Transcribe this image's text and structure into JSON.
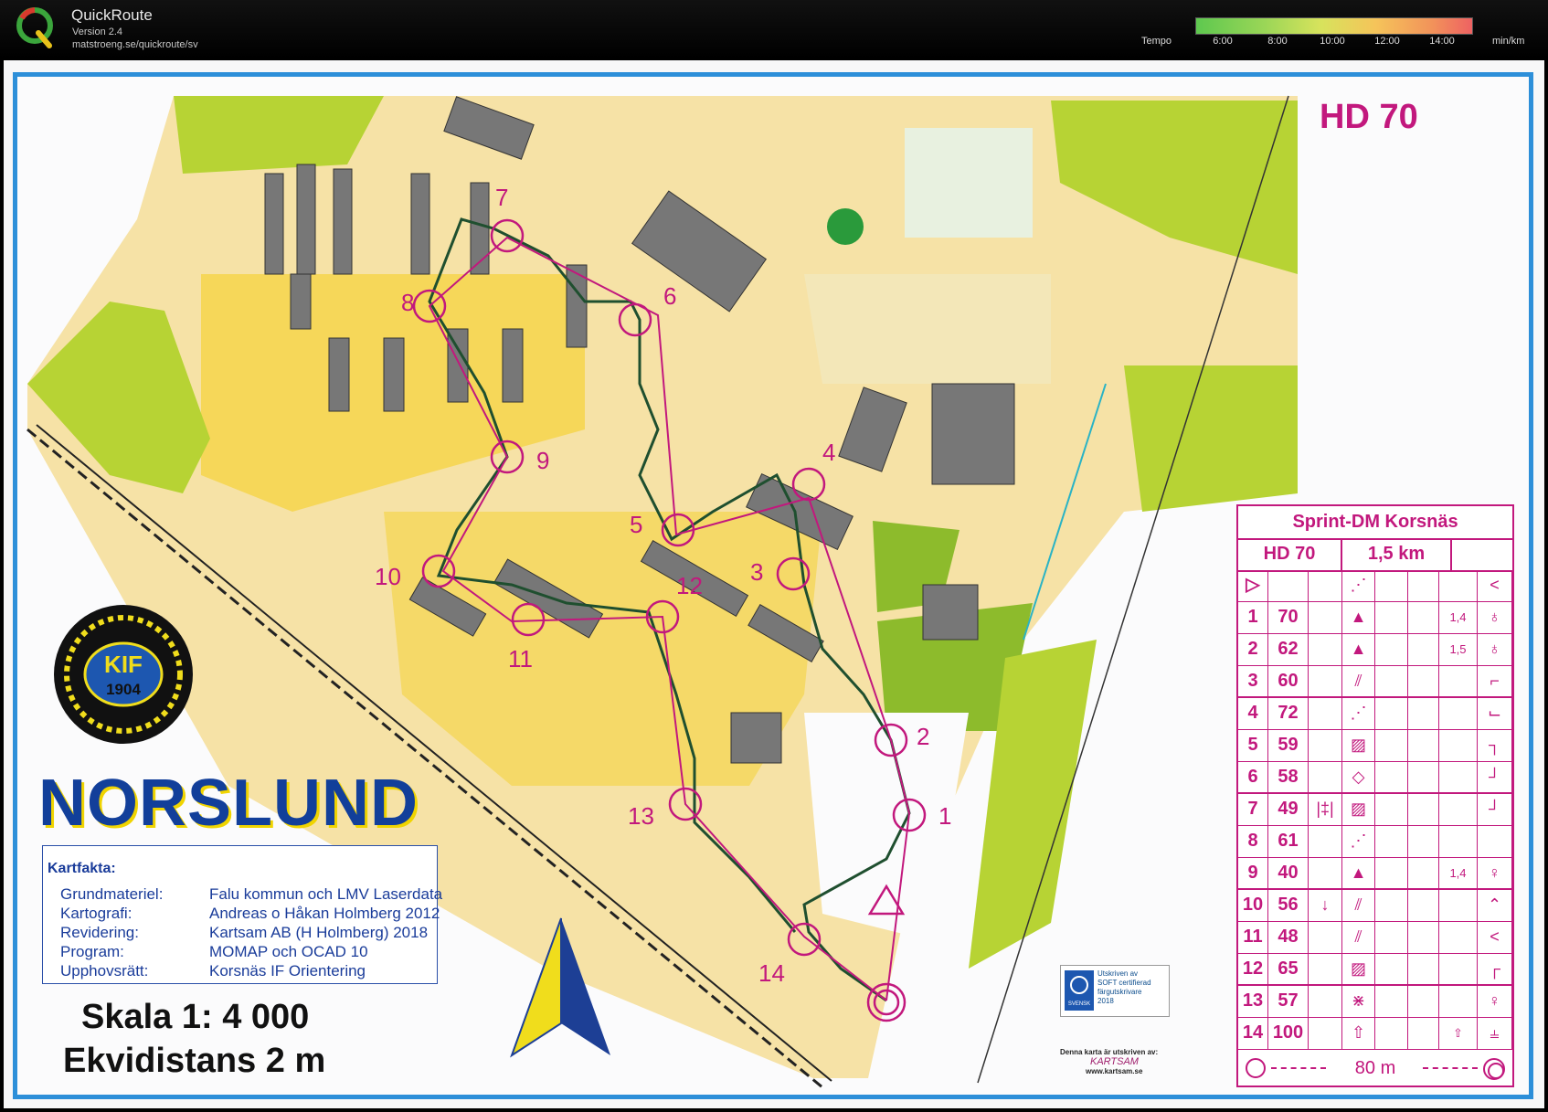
{
  "app": {
    "name": "QuickRoute",
    "version": "Version 2.4",
    "url": "matstroeng.se/quickroute/sv",
    "tempo_label": "Tempo",
    "tempo_ticks": [
      "6:00",
      "8:00",
      "10:00",
      "12:00",
      "14:00"
    ],
    "tempo_unit": "min/km"
  },
  "map": {
    "name": "NORSLUND",
    "course": "HD 70",
    "scale": "Skala 1: 4 000",
    "equidistance": "Ekvidistans 2 m",
    "club_logo": {
      "top": "KIF",
      "year": "1904"
    },
    "facts": {
      "heading": "Kartfakta:",
      "rows": [
        {
          "key": "Grundmateriel:",
          "value": "Falu kommun och LMV Laserdata"
        },
        {
          "key": "Kartografi:",
          "value": "Andreas o Håkan Holmberg 2012"
        },
        {
          "key": "Revidering:",
          "value": "Kartsam AB (H Holmberg) 2018"
        },
        {
          "key": "Program:",
          "value": "MOMAP och OCAD 10"
        },
        {
          "key": "Upphovsrätt:",
          "value": "Korsnäs IF Orientering"
        }
      ]
    },
    "printer_badge": {
      "line1": "Utskriven av",
      "line2": "SOFT certifierad",
      "line3": "färgutskrivare",
      "brand": "SVENSK",
      "year": "2018"
    },
    "printed_by": "Denna karta är utskriven av:",
    "printer_name": "KARTSAM",
    "printer_url": "www.kartsam.se",
    "control_labels": [
      "1",
      "2",
      "3",
      "4",
      "5",
      "6",
      "7",
      "8",
      "9",
      "10",
      "11",
      "12",
      "13",
      "14"
    ]
  },
  "control_description": {
    "title": "Sprint-DM Korsnäs",
    "class": "HD 70",
    "length": "1,5 km",
    "rows": [
      {
        "n": "1",
        "code": "70",
        "g": "",
        "feature": "▲",
        "dim": "1,4",
        "detail": "♁"
      },
      {
        "n": "2",
        "code": "62",
        "g": "",
        "feature": "▲",
        "dim": "1,5",
        "detail": "♁"
      },
      {
        "n": "3",
        "code": "60",
        "g": "",
        "feature": "⫽",
        "dim": "",
        "detail": "⌐"
      },
      {
        "n": "4",
        "code": "72",
        "g": "",
        "feature": "⋰",
        "dim": "",
        "detail": "⌙"
      },
      {
        "n": "5",
        "code": "59",
        "g": "",
        "feature": "▨",
        "dim": "",
        "detail": "┐"
      },
      {
        "n": "6",
        "code": "58",
        "g": "",
        "feature": "◇",
        "dim": "",
        "detail": "┘"
      },
      {
        "n": "7",
        "code": "49",
        "g": "|‡|",
        "feature": "▨",
        "dim": "",
        "detail": "┘"
      },
      {
        "n": "8",
        "code": "61",
        "g": "",
        "feature": "⋰",
        "dim": "",
        "detail": ""
      },
      {
        "n": "9",
        "code": "40",
        "g": "",
        "feature": "▲",
        "dim": "1,4",
        "detail": "♀"
      },
      {
        "n": "10",
        "code": "56",
        "g": "↓",
        "feature": "⫽",
        "dim": "",
        "detail": "⌃"
      },
      {
        "n": "11",
        "code": "48",
        "g": "",
        "feature": "⫽",
        "dim": "",
        "detail": "<"
      },
      {
        "n": "12",
        "code": "65",
        "g": "",
        "feature": "▨",
        "dim": "",
        "detail": "┌"
      },
      {
        "n": "13",
        "code": "57",
        "g": "",
        "feature": "⋇",
        "dim": "",
        "detail": "♀"
      },
      {
        "n": "14",
        "code": "100",
        "g": "",
        "feature": "⇧",
        "dim": "⇧",
        "detail": "⫨"
      }
    ],
    "finish": "80 m"
  },
  "colors": {
    "course": "#c2187d",
    "route": "#1f4f2f",
    "frame": "#2d8fd9",
    "open_land": "#f5d33f",
    "green": "#b7d334",
    "building": "#777777"
  }
}
